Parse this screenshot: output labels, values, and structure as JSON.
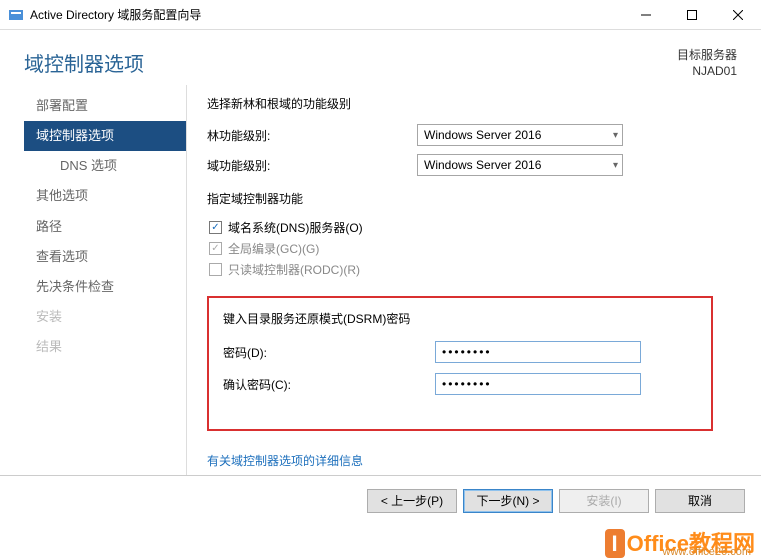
{
  "window": {
    "title": "Active Directory 域服务配置向导"
  },
  "header": {
    "pageTitle": "域控制器选项",
    "targetLabel": "目标服务器",
    "targetName": "NJAD01"
  },
  "sidebar": {
    "items": [
      {
        "label": "部署配置"
      },
      {
        "label": "域控制器选项"
      },
      {
        "label": "DNS 选项"
      },
      {
        "label": "其他选项"
      },
      {
        "label": "路径"
      },
      {
        "label": "查看选项"
      },
      {
        "label": "先决条件检查"
      },
      {
        "label": "安装"
      },
      {
        "label": "结果"
      }
    ]
  },
  "form": {
    "levelTitle": "选择新林和根域的功能级别",
    "forestLevelLabel": "林功能级别:",
    "forestLevelValue": "Windows Server 2016",
    "domainLevelLabel": "域功能级别:",
    "domainLevelValue": "Windows Server 2016",
    "dcCapTitle": "指定域控制器功能",
    "dnsLabel": "域名系统(DNS)服务器(O)",
    "gcLabel": "全局编录(GC)(G)",
    "rodcLabel": "只读域控制器(RODC)(R)",
    "dsrmTitle": "键入目录服务还原模式(DSRM)密码",
    "passwordLabel": "密码(D):",
    "passwordValue": "••••••••",
    "confirmLabel": "确认密码(C):",
    "confirmValue": "••••••••",
    "moreLink": "有关域控制器选项的详细信息"
  },
  "footer": {
    "prev": "< 上一步(P)",
    "next": "下一步(N) >",
    "install": "安装(I)",
    "cancel": "取消"
  },
  "watermark": {
    "brand": "Office教程网",
    "url": "www.office26.com"
  }
}
